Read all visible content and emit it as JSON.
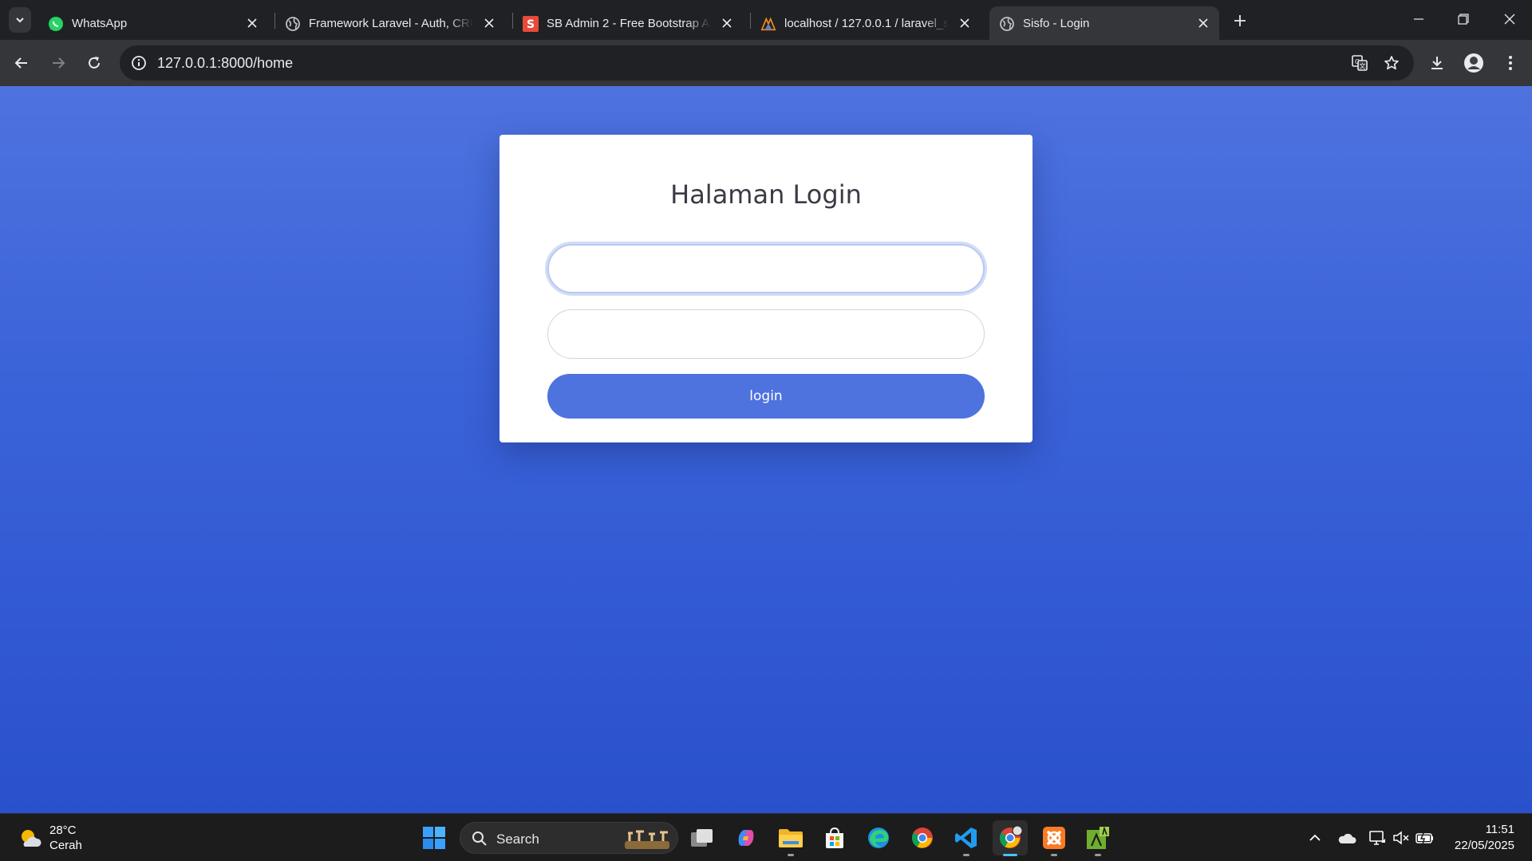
{
  "browser": {
    "tabs": [
      {
        "title": "WhatsApp",
        "icon": "whatsapp-icon"
      },
      {
        "title": "Framework Laravel - Auth, CRUD",
        "icon": "globe-icon"
      },
      {
        "title": "SB Admin 2 - Free Bootstrap Admin",
        "icon": "sb-admin-icon"
      },
      {
        "title": "localhost / 127.0.0.1 / laravel_sisfo",
        "icon": "phpmyadmin-icon"
      },
      {
        "title": "Sisfo - Login",
        "icon": "globe-icon"
      }
    ],
    "active_tab_index": 4,
    "url": "127.0.0.1:8000/home"
  },
  "login": {
    "title": "Halaman Login",
    "email_placeholder": "",
    "password_placeholder": "",
    "button_label": "login"
  },
  "taskbar": {
    "weather": {
      "temperature": "28°C",
      "condition": "Cerah"
    },
    "search_label": "Search",
    "apps": [
      "task-view",
      "copilot",
      "file-explorer",
      "microsoft-store",
      "edge",
      "chrome",
      "vscode",
      "chrome-profile",
      "xampp",
      "sublime-green"
    ],
    "clock": {
      "time": "11:51",
      "date": "22/05/2025"
    }
  },
  "colors": {
    "page_gradient_top": "#4e73df",
    "page_gradient_bottom": "#2a51cc",
    "primary_button": "#4e73df",
    "chrome_dark": "#202124",
    "chrome_toolbar": "#35363a"
  }
}
